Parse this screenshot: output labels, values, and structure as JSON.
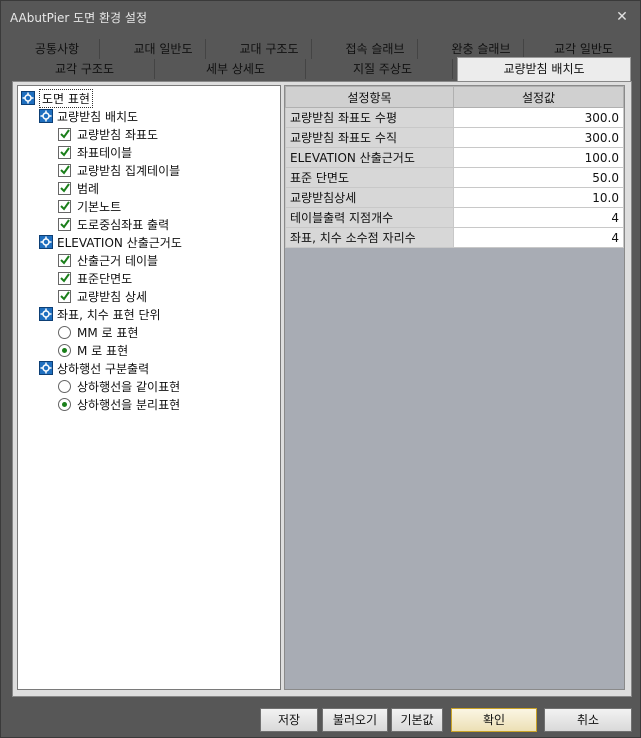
{
  "window": {
    "title": "AAbutPier 도면 환경 설정",
    "close_label": "✕"
  },
  "tabs_row1": [
    "공통사항",
    "교대 일반도",
    "교대 구조도",
    "접속 슬래브",
    "완충 슬래브",
    "교각 일반도"
  ],
  "tabs_row2": [
    "교각 구조도",
    "세부 상세도",
    "지질 주상도"
  ],
  "active_tab": "교량받침 배치도",
  "tree": {
    "root": "도면 표현",
    "group1": {
      "label": "교량받침 배치도",
      "items": [
        "교량받침 좌표도",
        "좌표테이블",
        "교량받침 집계테이블",
        "범례",
        "기본노트",
        "도로중심좌표 출력"
      ]
    },
    "group2": {
      "label": "ELEVATION 산출근거도",
      "items": [
        "산출근거 테이블",
        "표준단면도",
        "교량받침 상세"
      ]
    },
    "group3": {
      "label": "좌표, 치수 표현 단위",
      "options": [
        "MM 로 표현",
        "M 로 표현"
      ],
      "selected": 1
    },
    "group4": {
      "label": "상하행선 구분출력",
      "options": [
        "상하행선을 같이표현",
        "상하행선을 분리표현"
      ],
      "selected": 1
    }
  },
  "table": {
    "headers": [
      "설정항목",
      "설정값"
    ],
    "rows": [
      [
        "교량받침 좌표도 수평",
        "300.0"
      ],
      [
        "교량받침 좌표도 수직",
        "300.0"
      ],
      [
        "ELEVATION 산출근거도",
        "100.0"
      ],
      [
        "표준 단면도",
        "50.0"
      ],
      [
        "교량받침상세",
        "10.0"
      ],
      [
        "테이블출력 지점개수",
        "4"
      ],
      [
        "좌표, 치수 소수점 자리수",
        "4"
      ]
    ]
  },
  "buttons": {
    "save": "저장",
    "load": "불러오기",
    "default": "기본값",
    "ok": "확인",
    "cancel": "취소"
  },
  "colors": {
    "check": "#1a7f1a",
    "node_icon": "#1f6fbf",
    "accent_border": "#c9a227"
  }
}
